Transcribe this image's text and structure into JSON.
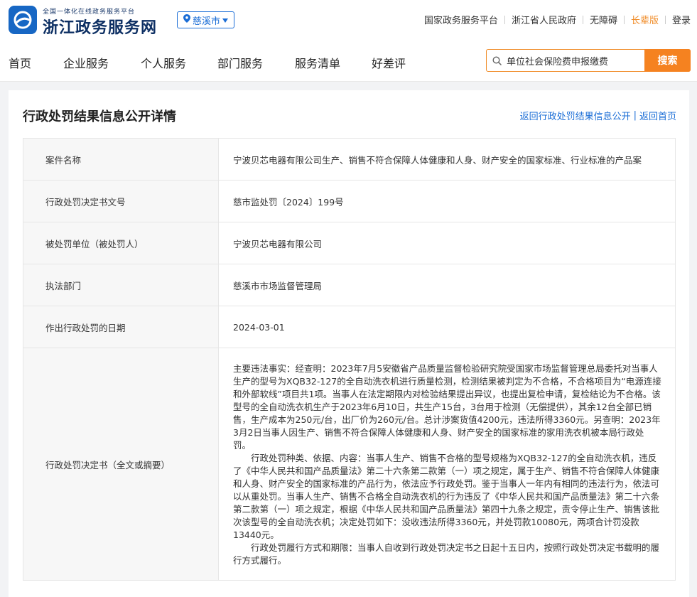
{
  "header": {
    "brand_sub": "全国一体化在线政务服务平台",
    "brand_main": "浙江政务服务网",
    "region": "慈溪市",
    "links": [
      "国家政务服务平台",
      "浙江省人民政府",
      "无障碍",
      "长辈版",
      "登录"
    ]
  },
  "nav": {
    "items": [
      "首页",
      "企业服务",
      "个人服务",
      "部门服务",
      "服务清单",
      "好差评"
    ],
    "search_value": "单位社会保险费申报缴费",
    "search_button": "搜索"
  },
  "page": {
    "title": "行政处罚结果信息公开详情",
    "back_link": "返回行政处罚结果信息公开",
    "home_link": "返回首页"
  },
  "detail": {
    "case_name_label": "案件名称",
    "case_name": "宁波贝芯电器有限公司生产、销售不符合保障人体健康和人身、财产安全的国家标准、行业标准的产品案",
    "doc_no_label": "行政处罚决定书文号",
    "doc_no": "慈市监处罚〔2024〕199号",
    "party_label": "被处罚单位（被处罚人）",
    "party": "宁波贝芯电器有限公司",
    "dept_label": "执法部门",
    "dept": "慈溪市市场监督管理局",
    "date_label": "作出行政处罚的日期",
    "date": "2024-03-01",
    "summary_label": "行政处罚决定书（全文或摘要）",
    "summary": [
      "主要违法事实：经查明：2023年7月5安徽省产品质量监督检验研究院受国家市场监督管理总局委托对当事人生产的型号为XQB32-127的全自动洗衣机进行质量检测，检测结果被判定为不合格，不合格项目为“电源连接和外部软线”项目共1项。当事人在法定期限内对检验结果提出异议，也提出复检申请，复检结论为不合格。该型号的全自动洗衣机生产于2023年6月10日，共生产15台，3台用于检测（无偿提供），其余12台全部已销售，生产成本为250元/台，出厂价为260元/台。总计涉案货值4200元，违法所得3360元。另查明：2023年3月2日当事人因生产、销售不符合保障人体健康和人身、财产安全的国家标准的家用洗衣机被本局行政处罚。",
      "行政处罚种类、依据、内容：当事人生产、销售不合格的型号规格为XQB32-127的全自动洗衣机，违反了《中华人民共和国产品质量法》第二十六条第二款第（一）项之规定，属于生产、销售不符合保障人体健康和人身、财产安全的国家标准的产品行为，依法应予行政处罚。鉴于当事人一年内有相同的违法行为，依法可以从重处罚。当事人生产、销售不合格全自动洗衣机的行为违反了《中华人民共和国产品质量法》第二十六条第二款第（一）项之规定，根据《中华人民共和国产品质量法》第四十九条之规定，责令停止生产、销售该批次该型号的全自动洗衣机；决定处罚如下：没收违法所得3360元，并处罚款10080元，两项合计罚没款13440元。",
      "行政处罚履行方式和期限：当事人自收到行政处罚决定书之日起十五日内，按照行政处罚决定书载明的履行方式履行。"
    ]
  },
  "colors": {
    "accent_blue": "#1a6dd6",
    "search_orange": "#f58220",
    "elder_orange": "#f08a24"
  },
  "icons": [
    "logo-icon",
    "location-pin-icon",
    "chevron-down-icon",
    "search-icon"
  ]
}
